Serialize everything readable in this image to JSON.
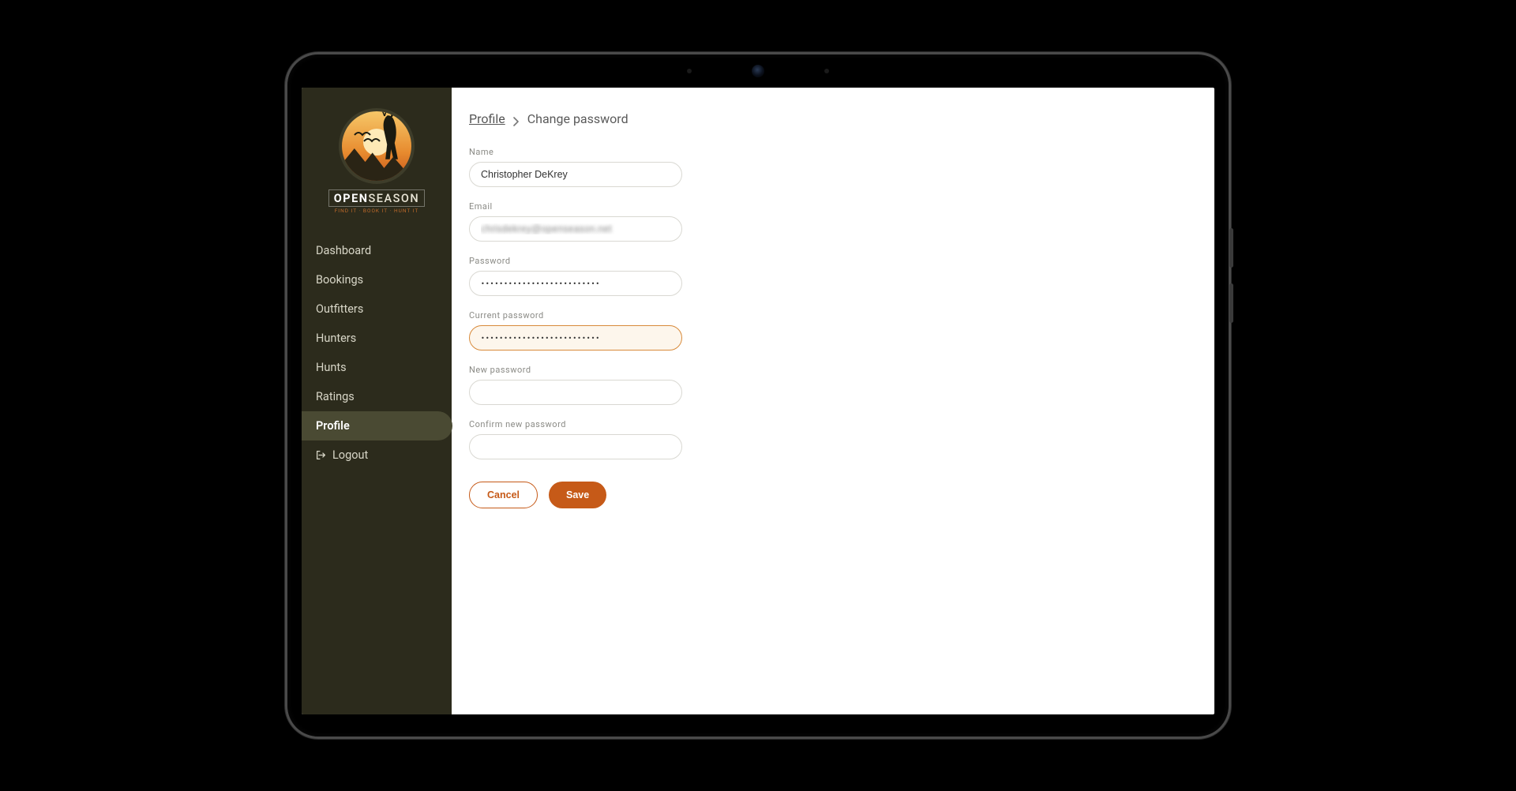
{
  "brand": {
    "word1": "OPEN",
    "word2": "SEASON",
    "tagline": "FIND IT · BOOK IT · HUNT IT"
  },
  "sidebar": {
    "items": [
      {
        "label": "Dashboard"
      },
      {
        "label": "Bookings"
      },
      {
        "label": "Outfitters"
      },
      {
        "label": "Hunters"
      },
      {
        "label": "Hunts"
      },
      {
        "label": "Ratings"
      },
      {
        "label": "Profile",
        "active": true
      },
      {
        "label": "Logout",
        "icon": "logout"
      }
    ]
  },
  "breadcrumb": {
    "parent": "Profile",
    "current": "Change password"
  },
  "form": {
    "name_label": "Name",
    "name_value": "Christopher DeKrey",
    "email_label": "Email",
    "email_value": "chrisdekrey@openseason.net",
    "password_label": "Password",
    "password_value": "••••••••••••••••••••••••••",
    "current_pw_label": "Current password",
    "current_pw_value": "••••••••••••••••••••••••••",
    "new_pw_label": "New password",
    "new_pw_value": "",
    "confirm_pw_label": "Confirm new password",
    "confirm_pw_value": ""
  },
  "actions": {
    "cancel": "Cancel",
    "save": "Save"
  }
}
